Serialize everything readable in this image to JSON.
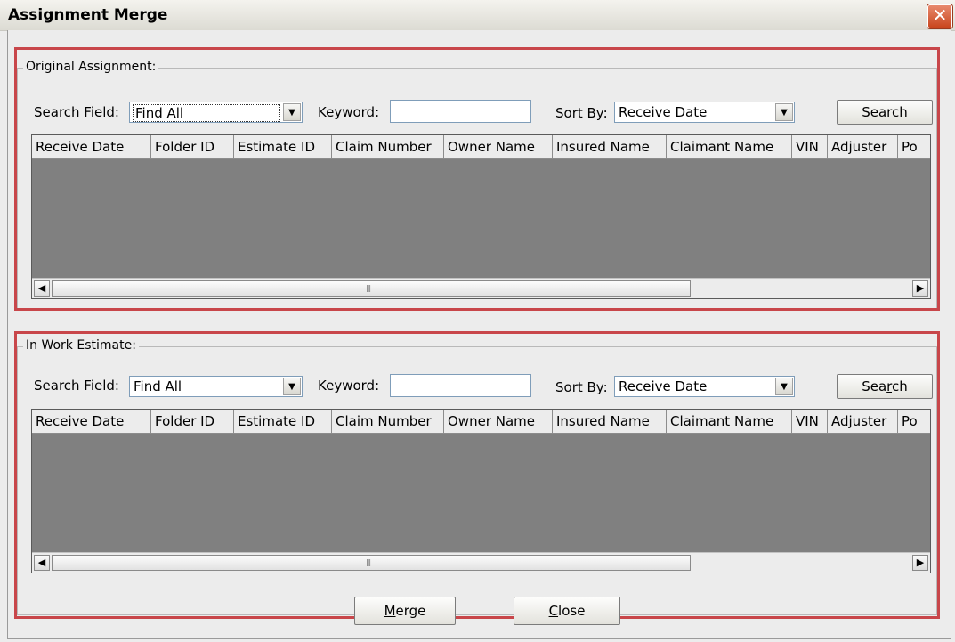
{
  "window": {
    "title": "Assignment Merge",
    "close_glyph": "✕"
  },
  "columns": [
    "Receive Date",
    "Folder ID",
    "Estimate ID",
    "Claim Number",
    "Owner Name",
    "Insured Name",
    "Claimant Name",
    "VIN",
    "Adjuster",
    "Po"
  ],
  "original": {
    "legend": "Original Assignment:",
    "search_field_label": "Search Field:",
    "search_field_value": "Find All",
    "keyword_label": "Keyword:",
    "keyword_value": "",
    "sort_by_label": "Sort By:",
    "sort_by_value": "Receive Date",
    "search_button_pre": "",
    "search_button_key": "S",
    "search_button_post": "earch"
  },
  "inwork": {
    "legend": "In Work Estimate:",
    "search_field_label": "Search Field:",
    "search_field_value": "Find All",
    "keyword_label": "Keyword:",
    "keyword_value": "",
    "sort_by_label": "Sort By:",
    "sort_by_value": "Receive Date",
    "search_button_pre": "Sea",
    "search_button_key": "r",
    "search_button_post": "ch"
  },
  "footer": {
    "merge_key": "M",
    "merge_rest": "erge",
    "close_key": "C",
    "close_rest": "lose"
  },
  "icons": {
    "dropdown": "▼",
    "scroll_left": "◀",
    "scroll_right": "▶",
    "thumb_grip": "|||"
  }
}
